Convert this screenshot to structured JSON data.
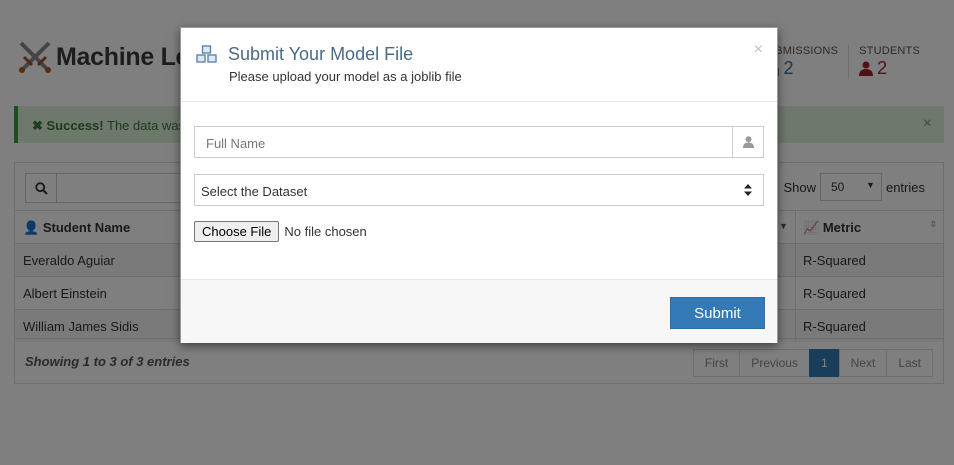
{
  "app": {
    "title": "Machine Le",
    "stats": [
      {
        "label": "SUBMISSIONS",
        "value": "2",
        "icon": "cubes-icon"
      },
      {
        "label": "STUDENTS",
        "value": "2",
        "icon": "user-icon"
      }
    ]
  },
  "alert": {
    "strong": "Success!",
    "text": "The data was",
    "close": "×"
  },
  "table_toolbar": {
    "show_label": "Show",
    "entries_value": "50",
    "entries_label": "entries"
  },
  "table": {
    "headers": {
      "name": "Student Name",
      "metric": "Metric"
    },
    "rows": [
      {
        "name": "Everaldo Aguiar",
        "metric": "R-Squared"
      },
      {
        "name": "Albert Einstein",
        "metric": "R-Squared"
      },
      {
        "name": "William James Sidis",
        "metric": "R-Squared"
      }
    ],
    "showing": "Showing 1 to 3 of 3 entries",
    "pagination": [
      "First",
      "Previous",
      "1",
      "Next",
      "Last"
    ]
  },
  "modal": {
    "title": "Submit Your Model File",
    "subtitle": "Please upload your model as a joblib file",
    "close": "×",
    "name_placeholder": "Full Name",
    "dataset_select": "Select the Dataset",
    "file_button": "Choose File",
    "file_status": "No file chosen",
    "submit": "Submit"
  },
  "colors": {
    "primary": "#337ab7",
    "title": "#4a6a85",
    "success_bg": "#dff0d8",
    "danger": "#a4212b"
  }
}
